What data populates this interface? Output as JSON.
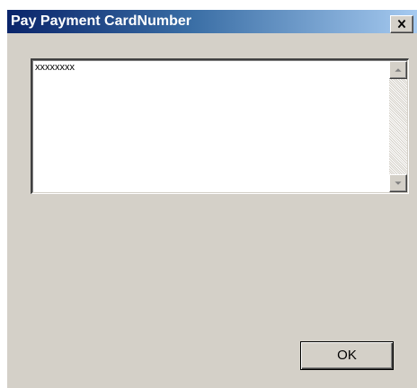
{
  "window": {
    "title": "Pay Payment CardNumber"
  },
  "textarea": {
    "value": "xxxxxxxx"
  },
  "buttons": {
    "ok_label": "OK"
  },
  "icons": {
    "close": "close-icon",
    "scroll_up": "scroll-up-arrow-icon",
    "scroll_down": "scroll-down-arrow-icon"
  },
  "colors": {
    "title_start": "#0a246a",
    "title_end": "#a6caf0",
    "face": "#d4d0c8"
  }
}
